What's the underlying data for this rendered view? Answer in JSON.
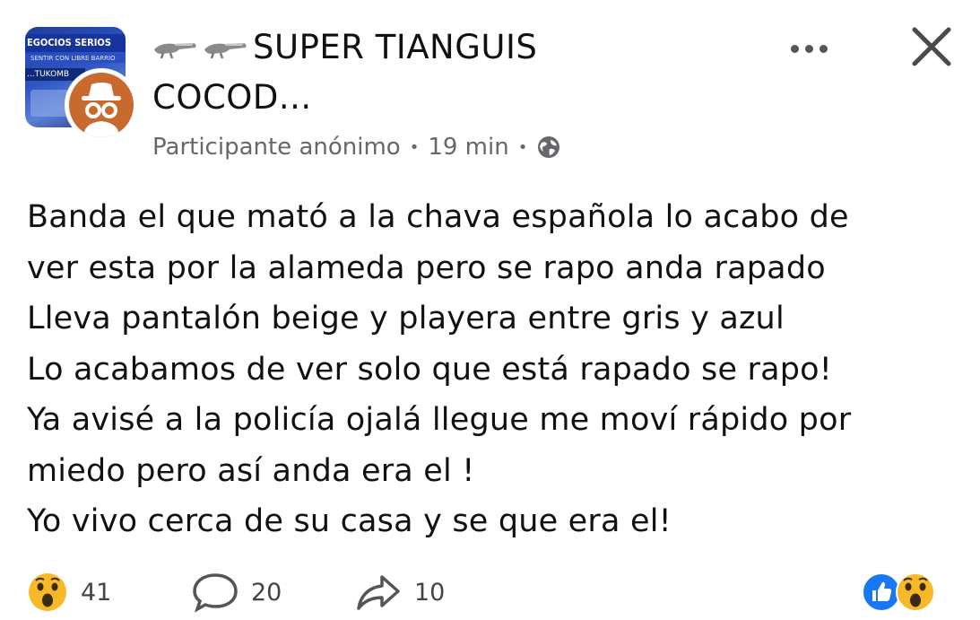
{
  "header": {
    "group_thumb_text_1": "EGOCIOS SERIOS",
    "group_thumb_text_2": "SENTIR CON LIBRE BARRIO",
    "group_thumb_text_3": "...TUKOMB",
    "group_name_line1": "SUPER TIANGUIS",
    "group_name_line2": "COCOD...",
    "author": "Participante anónimo",
    "separator": "•",
    "time": "19 min",
    "privacy_icon": "globe-icon"
  },
  "post": {
    "lines": [
      "Banda el que mató a la chava española lo acabo de",
      "ver esta por la alameda pero se rapo anda rapado",
      "Lleva pantalón beige y playera entre gris y azul",
      "Lo acabamos de ver solo que  está rapado se rapo!",
      "Ya avisé a la policía ojalá llegue me moví rápido por",
      "miedo pero así anda era el !",
      "Yo vivo cerca de su casa y se que era el!"
    ]
  },
  "footer": {
    "reactions_count": "41",
    "comments_count": "20",
    "shares_count": "10",
    "reaction_icon": "wow-emoji-icon",
    "comment_icon": "comment-bubble-icon",
    "share_icon": "share-arrow-icon"
  },
  "colors": {
    "facebook_blue": "#1877f2",
    "wow_yellow": "#f7b928",
    "avatar_orange": "#c8692e",
    "meta_gray": "#65676b"
  }
}
